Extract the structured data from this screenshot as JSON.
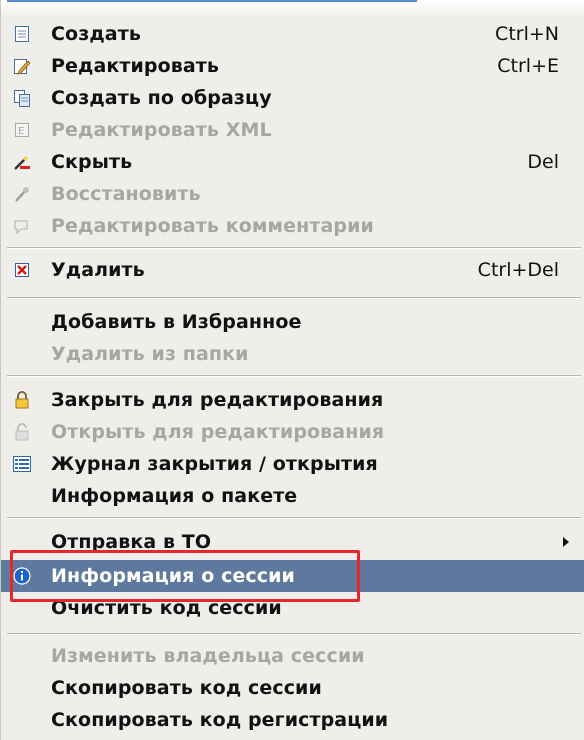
{
  "menu": {
    "items": [
      {
        "label": "Создать",
        "shortcut": "Ctrl+N",
        "icon": "document-new-icon",
        "disabled": false
      },
      {
        "label": "Редактировать",
        "shortcut": "Ctrl+E",
        "icon": "document-edit-icon",
        "disabled": false
      },
      {
        "label": "Создать по образцу",
        "shortcut": "",
        "icon": "copy-template-icon",
        "disabled": false
      },
      {
        "label": "Редактировать XML",
        "shortcut": "",
        "icon": "xml-edit-icon",
        "disabled": true
      },
      {
        "label": "Скрыть",
        "shortcut": "Del",
        "icon": "wand-hide-icon",
        "disabled": false
      },
      {
        "label": "Восстановить",
        "shortcut": "",
        "icon": "restore-icon",
        "disabled": true
      },
      {
        "label": "Редактировать комментарии",
        "shortcut": "",
        "icon": "comment-edit-icon",
        "disabled": true
      },
      {
        "label": "Удалить",
        "shortcut": "Ctrl+Del",
        "icon": "delete-icon",
        "disabled": false
      },
      {
        "label": "Добавить в Избранное",
        "shortcut": "",
        "icon": "",
        "disabled": false
      },
      {
        "label": "Удалить из папки",
        "shortcut": "",
        "icon": "",
        "disabled": true
      },
      {
        "label": "Закрыть для редактирования",
        "shortcut": "",
        "icon": "lock-icon",
        "disabled": false
      },
      {
        "label": "Открыть для редактирования",
        "shortcut": "",
        "icon": "unlock-icon",
        "disabled": true
      },
      {
        "label": "Журнал закрытия / открытия",
        "shortcut": "",
        "icon": "list-log-icon",
        "disabled": false
      },
      {
        "label": "Информация о пакете",
        "shortcut": "",
        "icon": "",
        "disabled": false
      },
      {
        "label": "Отправка в ТО",
        "shortcut": "",
        "icon": "",
        "disabled": false,
        "submenu": true
      },
      {
        "label": "Информация о сессии",
        "shortcut": "",
        "icon": "info-icon",
        "disabled": false,
        "selected": true
      },
      {
        "label": "Очистить код сессии",
        "shortcut": "",
        "icon": "",
        "disabled": false
      },
      {
        "label": "Изменить владельца сессии",
        "shortcut": "",
        "icon": "",
        "disabled": true
      },
      {
        "label": "Скопировать код сессии",
        "shortcut": "",
        "icon": "",
        "disabled": false
      },
      {
        "label": "Скопировать код регистрации",
        "shortcut": "",
        "icon": "",
        "disabled": false
      }
    ]
  },
  "colors": {
    "menu_background": "#f0eeea",
    "selected_background": "#5d7a9e",
    "highlight_border": "#e8262a",
    "disabled_text": "#a7a6a1"
  }
}
